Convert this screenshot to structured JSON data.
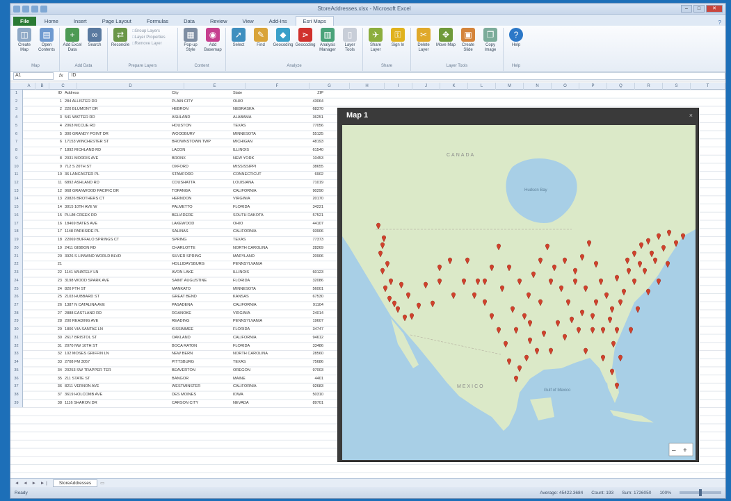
{
  "window": {
    "title": "StoreAddresses.xlsx - Microsoft Excel"
  },
  "ribbon": {
    "tabs": [
      "File",
      "Home",
      "Insert",
      "Page Layout",
      "Formulas",
      "Data",
      "Review",
      "View",
      "Add-Ins",
      "Esri Maps"
    ],
    "active_tab": "Esri Maps",
    "groups": [
      {
        "name": "Map",
        "buttons": [
          "Create Map",
          "Open Contents"
        ]
      },
      {
        "name": "Add Data",
        "buttons": [
          "Add Excel Data",
          "Search"
        ]
      },
      {
        "name": "Prepare Layers",
        "buttons": [
          "Reconcile"
        ],
        "small": [
          "Group Layers",
          "Layer Properties",
          "Remove Layer"
        ]
      },
      {
        "name": "Content",
        "buttons": [
          "Pop-up Style",
          "Add Basemap"
        ]
      },
      {
        "name": "Analyze",
        "buttons": [
          "Select",
          "Find",
          "Geocoding",
          "Geocoding",
          "Analysis Manager",
          "Layer Tools"
        ]
      },
      {
        "name": "Share",
        "buttons": [
          "Share Layer",
          "Sign In"
        ]
      },
      {
        "name": "Layer Tools",
        "buttons": [
          "Delete Layer",
          "Move Map",
          "Create Slide",
          "Copy Image"
        ]
      },
      {
        "name": "Help",
        "buttons": [
          "Help"
        ]
      }
    ]
  },
  "formula_bar": {
    "name_box": "A1",
    "fx": "fx",
    "formula": "ID"
  },
  "columns": {
    "letters": [
      "A",
      "B",
      "C",
      "D",
      "E",
      "F",
      "G",
      "H",
      "I",
      "J",
      "K",
      "L",
      "M",
      "N",
      "O",
      "P",
      "Q",
      "R",
      "S",
      "T"
    ],
    "headers": [
      "ID",
      "Address",
      "City",
      "State",
      "ZIP"
    ]
  },
  "rows": [
    [
      "1",
      "284 ALLISTER DR",
      "PLAIN CITY",
      "OHIO",
      "43064"
    ],
    [
      "2",
      "220 BLUMONT DR",
      "HEBRON",
      "NEBRASKA",
      "68370"
    ],
    [
      "3",
      "541 WATTER RD",
      "ASHLAND",
      "ALABAMA",
      "36251"
    ],
    [
      "4",
      "2063 MCCUE RD",
      "HOUSTON",
      "TEXAS",
      "77056"
    ],
    [
      "5",
      "300 GRANDY POINT DR",
      "WOODBURY",
      "MINNESOTA",
      "55125"
    ],
    [
      "6",
      "17153 WINCHESTER ST",
      "BROWNSTOWN TWP",
      "MICHIGAN",
      "48193"
    ],
    [
      "7",
      "1892 RICHLAND RD",
      "LACON",
      "ILLINOIS",
      "61540"
    ],
    [
      "8",
      "2031 MORRIS AVE",
      "BRONX",
      "NEW YORK",
      "10453"
    ],
    [
      "9",
      "712 S 20TH ST",
      "OXFORD",
      "MISSISSIPPI",
      "38655"
    ],
    [
      "10",
      "36 LANCASTER PL",
      "STAMFORD",
      "CONNECTICUT",
      "6902"
    ],
    [
      "11",
      "6892 ASHLAND RD",
      "COUSHATTA",
      "LOUISIANA",
      "71019"
    ],
    [
      "12",
      "968 GRANWOOD PACIFIC DR",
      "TOPANGA",
      "CALIFORNIA",
      "90290"
    ],
    [
      "13",
      "20826 BROTHERS CT",
      "HERNDON",
      "VIRGINIA",
      "20170"
    ],
    [
      "14",
      "3015 10TH AVE W",
      "PALMETTO",
      "FLORIDA",
      "34221"
    ],
    [
      "15",
      "PLUM CREEK RD",
      "BELVIDERE",
      "SOUTH DAKOTA",
      "57521"
    ],
    [
      "16",
      "18469 BATES AVE",
      "LAKEWOOD",
      "OHIO",
      "44107"
    ],
    [
      "17",
      "1148 PARKSIDE PL",
      "SALINAS",
      "CALIFORNIA",
      "93906"
    ],
    [
      "18",
      "22069 BUFFALO SPRINGS CT",
      "SPRING",
      "TEXAS",
      "77373"
    ],
    [
      "19",
      "2411 GIBBON RD",
      "CHARLOTTE",
      "NORTH CAROLINA",
      "28269"
    ],
    [
      "20",
      "3926 S LINWIND WORLD BLVD",
      "SILVER SPRING",
      "MARYLAND",
      "20906"
    ],
    [
      "21",
      "",
      "HOLLIDAYSBURG",
      "PENNSYLVANIA",
      ""
    ],
    [
      "22",
      "1141 WHATELY LN",
      "AVON LAKE",
      "ILLINOIS",
      "60123"
    ],
    [
      "23",
      "3198 WOOD SPARK AVE",
      "SAINT AUGUSTINE",
      "FLORIDA",
      "32086"
    ],
    [
      "24",
      "820 FTH ST",
      "MANKATO",
      "MINNESOTA",
      "56001"
    ],
    [
      "25",
      "2103 HUBBARD ST",
      "GREAT BEND",
      "KANSAS",
      "67530"
    ],
    [
      "26",
      "1387 N CATALINA AVE",
      "PASADENA",
      "CALIFORNIA",
      "91104"
    ],
    [
      "27",
      "2888 EASTLAND RD",
      "ROANOKE",
      "VIRGINIA",
      "24014"
    ],
    [
      "28",
      "200 READING AVE",
      "READING",
      "PENNSYLVANIA",
      "19607"
    ],
    [
      "29",
      "1806 VIA SANTAE LN",
      "KISSIMMEE",
      "FLORIDA",
      "34747"
    ],
    [
      "30",
      "2617 BRISTOL ST",
      "OAKLAND",
      "CALIFORNIA",
      "94612"
    ],
    [
      "31",
      "2070 NW 10TH ST",
      "BOCA RATON",
      "FLORIDA",
      "33486"
    ],
    [
      "32",
      "102 MOSES GRIFFIN LN",
      "NEW BERN",
      "NORTH CAROLINA",
      "28560"
    ],
    [
      "33",
      "2708 FM 3057",
      "PITTSBURG",
      "TEXAS",
      "75686"
    ],
    [
      "34",
      "20253 SW TRAPPER TER",
      "BEAVERTON",
      "OREGON",
      "97003"
    ],
    [
      "35",
      "211 STATE ST",
      "BANGOR",
      "MAINE",
      "4401"
    ],
    [
      "36",
      "8211 VERNON AVE",
      "WESTMINSTER",
      "CALIFORNIA",
      "92683"
    ],
    [
      "37",
      "3619 HOLCOMB AVE",
      "DES MOINES",
      "IOWA",
      "50310"
    ],
    [
      "38",
      "1116 SHARON DR",
      "CARSON CITY",
      "NEVADA",
      "89701"
    ]
  ],
  "map": {
    "title": "Map 1",
    "close": "×",
    "labels": {
      "canada": "CANADA",
      "hudson": "Hudson Bay",
      "mexico": "MEXICO",
      "gulf": "Gulf of Mexico"
    },
    "marker_color": "#d0412c",
    "land_color": "#dbe9c8",
    "water_color": "#a8cfe6"
  },
  "sheet_tabs": {
    "active": "StoreAddresses",
    "nav": "◄ ◄ ► ►|"
  },
  "status": {
    "left": "Ready",
    "average": "Average: 45422.3684",
    "count": "Count: 193",
    "sum": "Sum: 1726050",
    "zoom": "100%"
  },
  "icons": {
    "create_map": "globe-map-icon",
    "add_data": "add-layer-icon",
    "search": "binoculars-icon",
    "select": "pointer-icon",
    "help": "question-mark-icon",
    "sign_in": "lock-icon"
  }
}
